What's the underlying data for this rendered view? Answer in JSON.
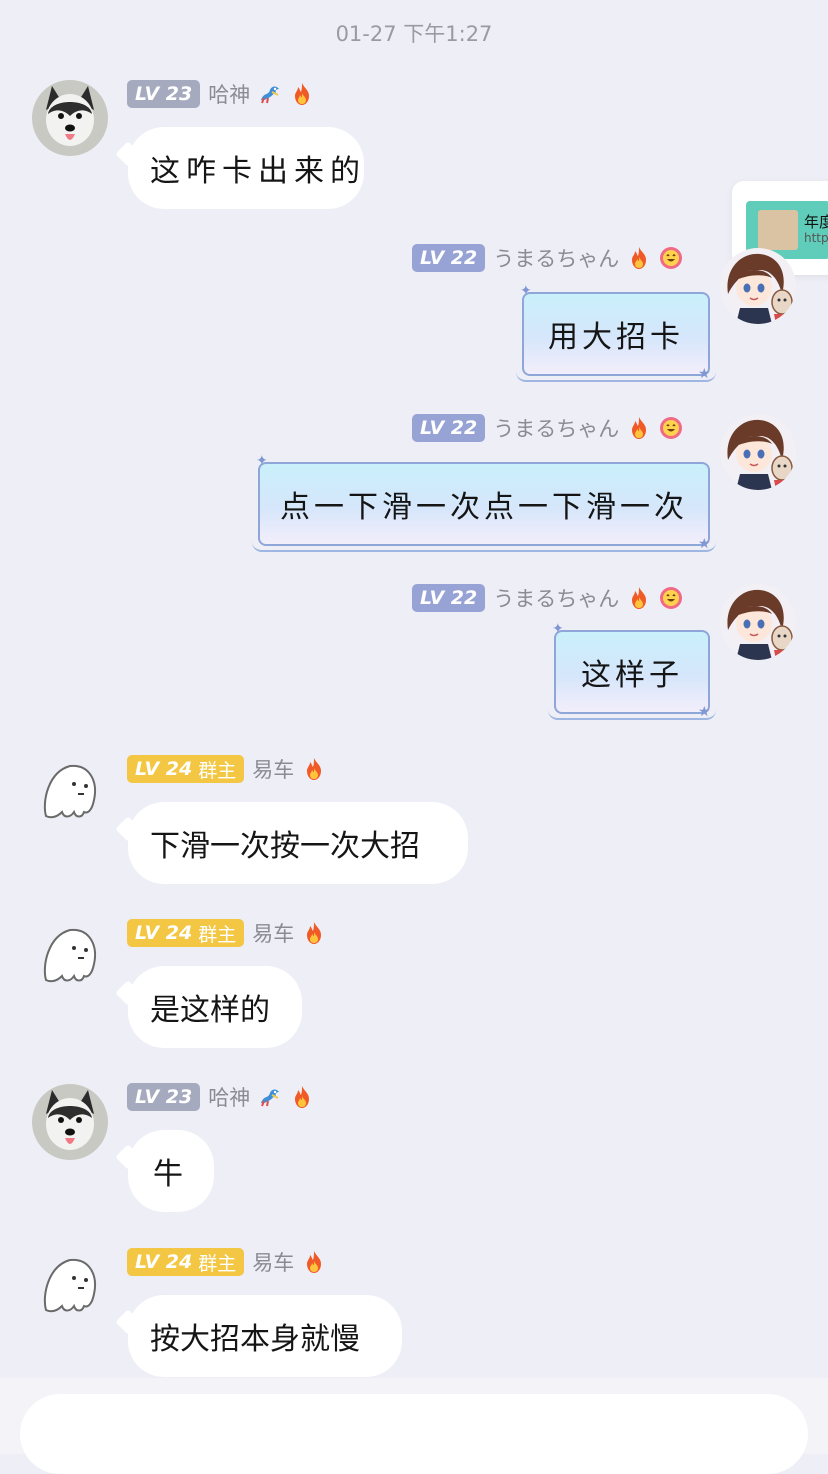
{
  "timestamp": "01-27 下午1:27",
  "share_card": {
    "title": "年度",
    "url": "http"
  },
  "messages": [
    {
      "level": "LV 23",
      "role": "",
      "nickname": "哈神",
      "text": "这咋卡出来的"
    },
    {
      "level": "LV 22",
      "role": "",
      "nickname": "うまるちゃん",
      "text": "用大招卡"
    },
    {
      "level": "LV 22",
      "role": "",
      "nickname": "うまるちゃん",
      "text": "点一下滑一次点一下滑一次"
    },
    {
      "level": "LV 22",
      "role": "",
      "nickname": "うまるちゃん",
      "text": "这样子"
    },
    {
      "level": "LV 24",
      "role": "群主",
      "nickname": "易车",
      "text": "下滑一次按一次大招"
    },
    {
      "level": "LV 24",
      "role": "群主",
      "nickname": "易车",
      "text": "是这样的"
    },
    {
      "level": "LV 23",
      "role": "",
      "nickname": "哈神",
      "text": "牛"
    },
    {
      "level": "LV 24",
      "role": "群主",
      "nickname": "易车",
      "text": "按大招本身就慢"
    }
  ],
  "icons": {
    "dragon": "dragon-emoji-icon",
    "fire": "fire-emoji-icon",
    "smile": "smiling-face-emoji-icon",
    "husky": "husky-avatar",
    "ghost": "ghost-avatar",
    "anime": "anime-girl-avatar"
  },
  "colors": {
    "background": "#eeeef6",
    "badge_gray": "#a5aabf",
    "badge_blue": "#97a3d4",
    "badge_gold": "#f3c743",
    "bubble": "#ffffff"
  }
}
